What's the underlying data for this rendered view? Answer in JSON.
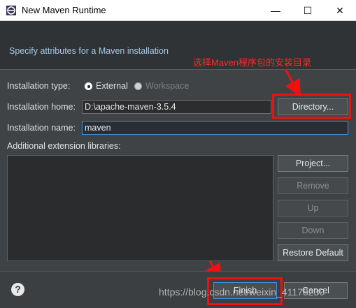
{
  "window": {
    "title": "New Maven Runtime",
    "minimize": "—",
    "maximize": "☐",
    "close": "✕"
  },
  "banner": {
    "text": "Specify attributes for a Maven installation"
  },
  "annotation": {
    "text": "选择Maven程序包的安装目录"
  },
  "form": {
    "type_label": "Installation type:",
    "type_external": "External",
    "type_workspace": "Workspace",
    "home_label": "Installation home:",
    "home_value": "D:\\apache-maven-3.5.4",
    "name_label": "Installation name:",
    "name_value": "maven",
    "libs_label": "Additional extension libraries:"
  },
  "buttons": {
    "directory": "Directory...",
    "project": "Project...",
    "remove": "Remove",
    "up": "Up",
    "down": "Down",
    "restore": "Restore Default",
    "finish": "Finish",
    "cancel": "Cancel"
  },
  "footer": {
    "help": "?"
  },
  "watermark": {
    "text": "https://blog.csdn.net/weixin_41178230"
  },
  "colors": {
    "annotation_red": "#ee1111",
    "banner_text": "#a7c9e6",
    "focus": "#3d8fd8"
  },
  "icons": {
    "app": "eclipse-icon",
    "help": "help-icon"
  }
}
